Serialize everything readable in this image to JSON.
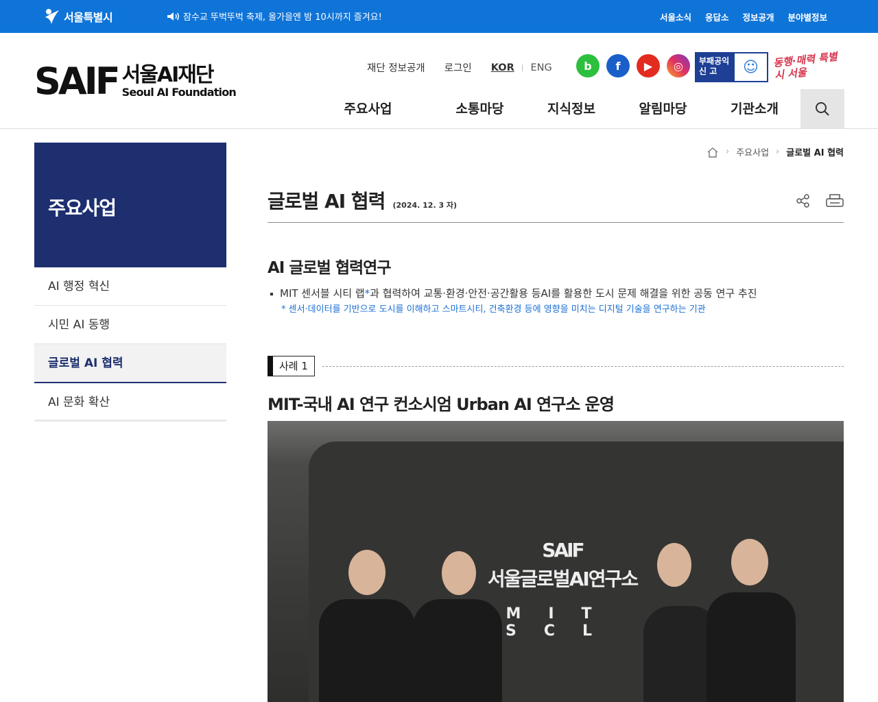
{
  "topbar": {
    "seoul_logo_text": "서울특별시",
    "notice": "잠수교 뚜벅뚜벅 축제, 올가을엔 밤 10시까지 즐겨요!",
    "util_links": [
      "서울소식",
      "응답소",
      "정보공개",
      "분야별정보"
    ]
  },
  "header": {
    "logo_mark": "SAIF",
    "logo_ko": "서울AI재단",
    "logo_en": "Seoul AI Foundation",
    "links": {
      "disclosure": "재단 정보공개",
      "login": "로그인",
      "kor": "KOR",
      "eng": "ENG"
    },
    "sns": {
      "blog": "b",
      "facebook": "f",
      "youtube": "▶",
      "instagram": "◎"
    },
    "report_label": "부패공익신 고",
    "slogan": "동행·매력 특별시 서울",
    "gnb": [
      "주요사업",
      "소통마당",
      "지식정보",
      "알림마당",
      "기관소개"
    ]
  },
  "sidebar": {
    "title": "주요사업",
    "items": [
      {
        "label": "AI 행정 혁신"
      },
      {
        "label": "시민 AI 동행"
      },
      {
        "label": "글로벌 AI 협력"
      },
      {
        "label": "AI 문화 확산"
      }
    ]
  },
  "breadcrumb": {
    "level1": "주요사업",
    "current": "글로벌 AI 협력"
  },
  "page": {
    "title": "글로벌 AI 협력",
    "date": "(2024. 12. 3 자)",
    "section_title": "AI 글로벌 협력연구",
    "bullet_a": "MIT 센서블 시티 랩",
    "bullet_ast": "*",
    "bullet_b": "과 협력하여 교통·환경·안전·공간활용 등AI를 활용한 도시 문제 해결을 위한 공동 연구 추진",
    "note": "* 센서·데이터를 기반으로 도시를 이해하고 스마트시티, 건축환경 등에 영향을 미치는 디지털 기술을 연구하는 기관",
    "case_tag": "사례 1",
    "case_title": "MIT-국내 AI 연구 컨소시엄 Urban AI 연구소 운영",
    "photo_sign": {
      "line1": "SAIF",
      "line2": "서울글로벌AI연구소",
      "line3": "MIT SCL"
    }
  },
  "colors": {
    "topbar": "#0f74d8",
    "sidebar_head": "#1d2f6f",
    "accent": "#1a6fd6"
  }
}
